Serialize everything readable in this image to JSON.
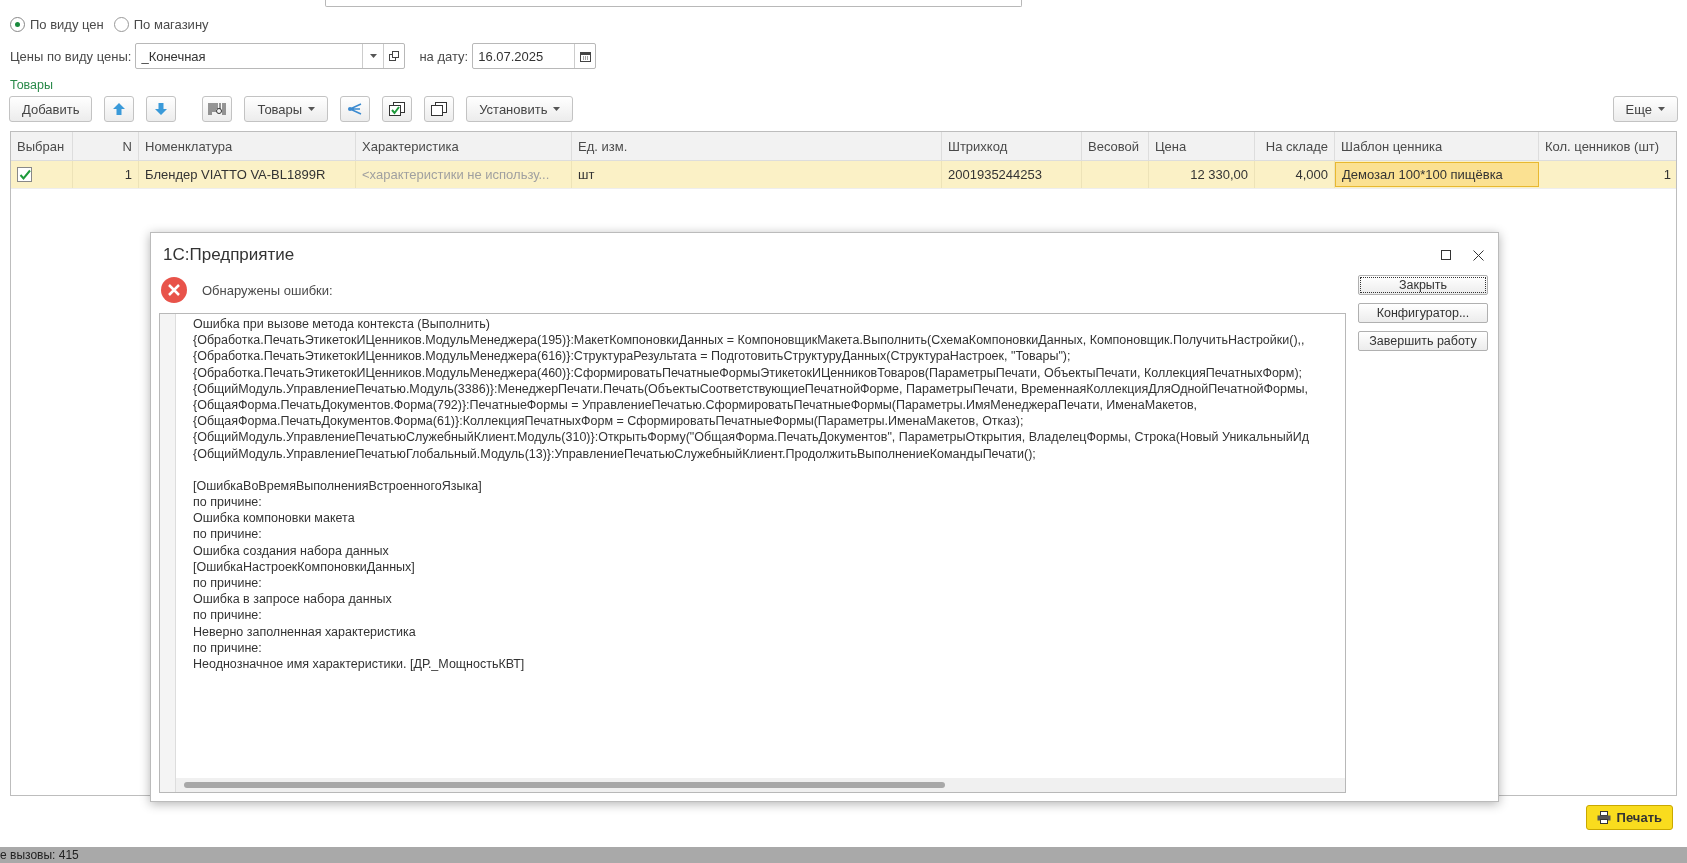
{
  "filter_mode": {
    "options": [
      {
        "label": "По виду цен",
        "selected": true
      },
      {
        "label": "По магазину",
        "selected": false
      }
    ]
  },
  "price_type": {
    "label": "Цены по виду цены:",
    "value": "_Конечная"
  },
  "date": {
    "label": "на дату:",
    "value": "16.07.2025"
  },
  "section_title": "Товары",
  "toolbar": {
    "items": [
      {
        "kind": "text",
        "label": "Добавить"
      },
      {
        "kind": "up-arrow"
      },
      {
        "kind": "down-arrow"
      },
      {
        "kind": "barcode"
      },
      {
        "kind": "dropdown",
        "label": "Товары"
      },
      {
        "kind": "share"
      },
      {
        "kind": "check-list"
      },
      {
        "kind": "copy"
      },
      {
        "kind": "dropdown",
        "label": "Установить"
      }
    ],
    "more": {
      "label": "Еще"
    }
  },
  "table": {
    "columns": [
      "Выбран",
      "N",
      "Номенклатура",
      "Характеристика",
      "Ед. изм.",
      "Штрихкод",
      "Весовой",
      "Цена",
      "На складе",
      "Шаблон ценника",
      "Кол. ценников (шт)"
    ],
    "rows": [
      {
        "selected": true,
        "cells": [
          {
            "kind": "checkbox",
            "checked": true
          },
          {
            "kind": "number",
            "text": "1"
          },
          {
            "kind": "text",
            "text": "Блендер VIATTO VA-BL1899R"
          },
          {
            "kind": "placeholder",
            "text": "<характеристики не использу..."
          },
          {
            "kind": "text",
            "text": "шт"
          },
          {
            "kind": "text",
            "text": "2001935244253"
          },
          {
            "kind": "text",
            "text": ""
          },
          {
            "kind": "number",
            "text": "12 330,00"
          },
          {
            "kind": "number",
            "text": "4,000"
          },
          {
            "kind": "current",
            "text": "Демозал 100*100 пищёвка"
          },
          {
            "kind": "number",
            "text": "1"
          }
        ]
      }
    ]
  },
  "dialog": {
    "title": "1С:Предприятие",
    "heading": "Обнаружены ошибки:",
    "message_blocks": [
      [
        "Ошибка при вызове метода контекста (Выполнить)",
        "{Обработка.ПечатьЭтикетокИЦенников.МодульМенеджера(195)}:МакетКомпоновкиДанных = КомпоновщикМакета.Выполнить(СхемаКомпоновкиДанных, Компоновщик.ПолучитьНастройки(),,",
        "{Обработка.ПечатьЭтикетокИЦенников.МодульМенеджера(616)}:СтруктураРезультата = ПодготовитьСтруктуруДанных(СтруктураНастроек, \"Товары\");",
        "{Обработка.ПечатьЭтикетокИЦенников.МодульМенеджера(460)}:СформироватьПечатныеФормыЭтикетокИЦенниковТоваров(ПараметрыПечати, ОбъектыПечати, КоллекцияПечатныхФорм);",
        "{ОбщийМодуль.УправлениеПечатью.Модуль(3386)}:МенеджерПечати.Печать(ОбъектыСоответствующиеПечатнойФорме, ПараметрыПечати, ВременнаяКоллекцияДляОднойПечатнойФормы,",
        "{ОбщаяФорма.ПечатьДокументов.Форма(792)}:ПечатныеФормы = УправлениеПечатью.СформироватьПечатныеФормы(Параметры.ИмяМенеджераПечати, ИменаМакетов,",
        "{ОбщаяФорма.ПечатьДокументов.Форма(61)}:КоллекцияПечатныхФорм = СформироватьПечатныеФормы(Параметры.ИменаМакетов, Отказ);",
        "{ОбщийМодуль.УправлениеПечатьюСлужебныйКлиент.Модуль(310)}:ОткрытьФорму(\"ОбщаяФорма.ПечатьДокументов\", ПараметрыОткрытия, ВладелецФормы, Строка(Новый УникальныйИд",
        "{ОбщийМодуль.УправлениеПечатьюГлобальный.Модуль(13)}:УправлениеПечатьюСлужебныйКлиент.ПродолжитьВыполнениеКомандыПечати();"
      ],
      [
        "[ОшибкаВоВремяВыполненияВстроенногоЯзыка]",
        "по причине:",
        "Ошибка компоновки макета",
        "по причине:",
        "Ошибка создания набора данных",
        "[ОшибкаНастроекКомпоновкиДанных]",
        "по причине:",
        "Ошибка в запросе набора данных",
        "по причине:",
        "Неверно заполненная характеристика",
        "по причине:",
        "Неоднозначное имя характеристики. [ДР._МощностьКВТ]"
      ]
    ],
    "buttons": [
      {
        "label": "Закрыть",
        "focused": true
      },
      {
        "label": "Конфигуратор...",
        "focused": false
      },
      {
        "label": "Завершить работу",
        "focused": false
      }
    ]
  },
  "print_button": {
    "label": "Печать"
  },
  "status_bar": {
    "text": "е вызовы: 415"
  }
}
